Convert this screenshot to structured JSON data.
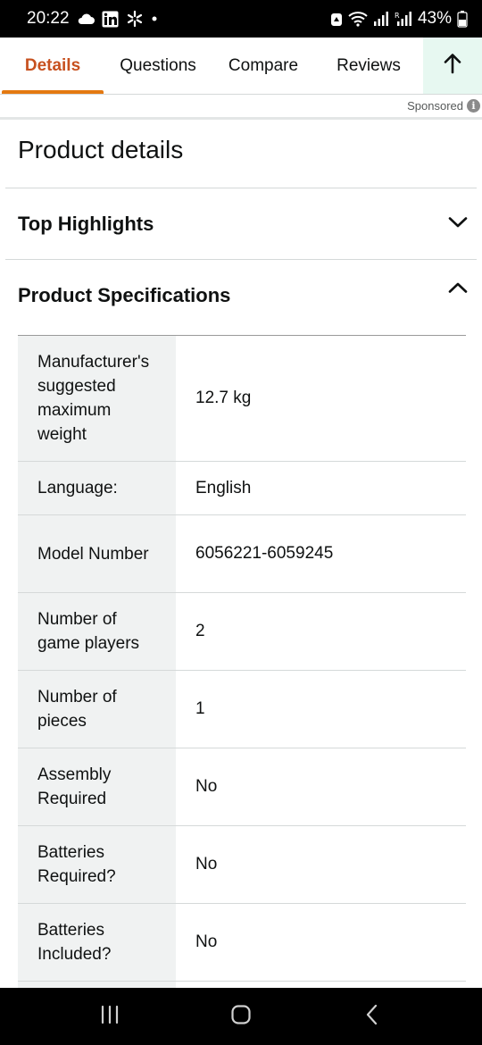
{
  "status_bar": {
    "time": "20:22",
    "battery": "43%",
    "left_icons": [
      "cloud-icon",
      "linkedin-icon",
      "walmart-icon",
      "dot-icon"
    ],
    "right_icons": [
      "alarm-icon",
      "wifi-icon",
      "signal-icon",
      "signal-r-icon",
      "battery-icon"
    ]
  },
  "tabs": [
    {
      "label": "Details",
      "active": true
    },
    {
      "label": "Questions",
      "active": false
    },
    {
      "label": "Compare",
      "active": false
    },
    {
      "label": "Reviews",
      "active": false
    }
  ],
  "sponsored": "Sponsored",
  "page_title": "Product details",
  "sections": {
    "highlights": {
      "title": "Top Highlights",
      "expanded": false
    },
    "specifications": {
      "title": "Product Specifications",
      "expanded": true
    }
  },
  "specs": [
    {
      "label": "Manufacturer's suggested maximum weight",
      "value": "12.7 kg"
    },
    {
      "label": "Language:",
      "value": "English"
    },
    {
      "label": "Model Number",
      "value": "6056221-6059245"
    },
    {
      "label": "Number of game players",
      "value": "2"
    },
    {
      "label": "Number of pieces",
      "value": "1"
    },
    {
      "label": "Assembly Required",
      "value": "No"
    },
    {
      "label": "Batteries Required?",
      "value": "No"
    },
    {
      "label": "Batteries Included?",
      "value": "No"
    }
  ],
  "colors": {
    "accent": "#e47911",
    "active_tab_text": "#c7511f",
    "up_button_bg": "#e7f8f1",
    "label_bg": "#f0f2f2"
  }
}
